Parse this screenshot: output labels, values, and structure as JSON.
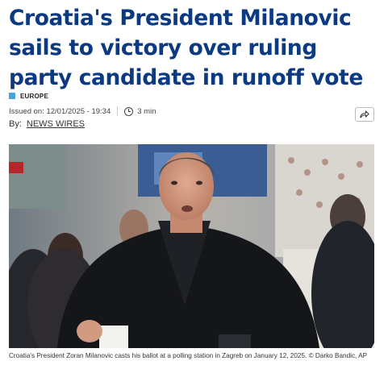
{
  "article": {
    "headline": "Croatia's President Milanovic sails to victory over ruling party candidate in runoff vote",
    "category": "EUROPE",
    "issued_on": "Issued on: 12/01/2025 - 19:34",
    "read_time": "3 min",
    "by_label": "By:",
    "author": "NEWS WIRES",
    "share_icon": "share-icon",
    "caption": "Croatia's President Zoran Milanovic casts his ballot at a polling station in Zagreb on January 12, 2025.",
    "credit": "© Darko Bandic, AP"
  },
  "colors": {
    "headline": "#0b3a82",
    "category_accent": "#4aa3df"
  }
}
